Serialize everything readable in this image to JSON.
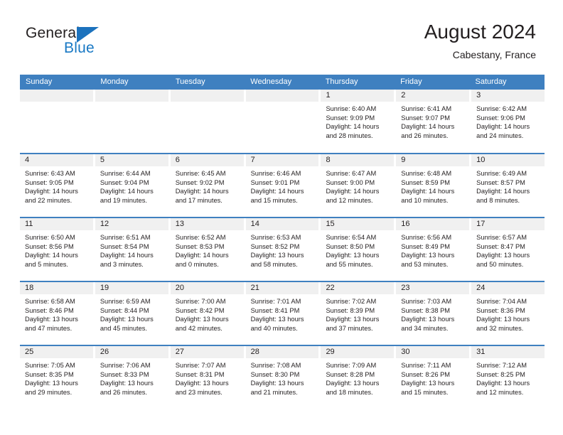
{
  "brand": {
    "name_top": "General",
    "name_bottom": "Blue",
    "triangle_color": "#1c72bd",
    "blue_text_color": "#1878c4"
  },
  "header": {
    "title": "August 2024",
    "subtitle": "Cabestany, France"
  },
  "theme": {
    "header_blue": "#3f80c0",
    "daynum_bg": "#f0f0f0",
    "text": "#231f20"
  },
  "weekdays": [
    "Sunday",
    "Monday",
    "Tuesday",
    "Wednesday",
    "Thursday",
    "Friday",
    "Saturday"
  ],
  "weeks": [
    [
      {
        "day": "",
        "sunrise": "",
        "sunset": "",
        "daylight": ""
      },
      {
        "day": "",
        "sunrise": "",
        "sunset": "",
        "daylight": ""
      },
      {
        "day": "",
        "sunrise": "",
        "sunset": "",
        "daylight": ""
      },
      {
        "day": "",
        "sunrise": "",
        "sunset": "",
        "daylight": ""
      },
      {
        "day": "1",
        "sunrise": "Sunrise: 6:40 AM",
        "sunset": "Sunset: 9:09 PM",
        "daylight": "Daylight: 14 hours and 28 minutes."
      },
      {
        "day": "2",
        "sunrise": "Sunrise: 6:41 AM",
        "sunset": "Sunset: 9:07 PM",
        "daylight": "Daylight: 14 hours and 26 minutes."
      },
      {
        "day": "3",
        "sunrise": "Sunrise: 6:42 AM",
        "sunset": "Sunset: 9:06 PM",
        "daylight": "Daylight: 14 hours and 24 minutes."
      }
    ],
    [
      {
        "day": "4",
        "sunrise": "Sunrise: 6:43 AM",
        "sunset": "Sunset: 9:05 PM",
        "daylight": "Daylight: 14 hours and 22 minutes."
      },
      {
        "day": "5",
        "sunrise": "Sunrise: 6:44 AM",
        "sunset": "Sunset: 9:04 PM",
        "daylight": "Daylight: 14 hours and 19 minutes."
      },
      {
        "day": "6",
        "sunrise": "Sunrise: 6:45 AM",
        "sunset": "Sunset: 9:02 PM",
        "daylight": "Daylight: 14 hours and 17 minutes."
      },
      {
        "day": "7",
        "sunrise": "Sunrise: 6:46 AM",
        "sunset": "Sunset: 9:01 PM",
        "daylight": "Daylight: 14 hours and 15 minutes."
      },
      {
        "day": "8",
        "sunrise": "Sunrise: 6:47 AM",
        "sunset": "Sunset: 9:00 PM",
        "daylight": "Daylight: 14 hours and 12 minutes."
      },
      {
        "day": "9",
        "sunrise": "Sunrise: 6:48 AM",
        "sunset": "Sunset: 8:59 PM",
        "daylight": "Daylight: 14 hours and 10 minutes."
      },
      {
        "day": "10",
        "sunrise": "Sunrise: 6:49 AM",
        "sunset": "Sunset: 8:57 PM",
        "daylight": "Daylight: 14 hours and 8 minutes."
      }
    ],
    [
      {
        "day": "11",
        "sunrise": "Sunrise: 6:50 AM",
        "sunset": "Sunset: 8:56 PM",
        "daylight": "Daylight: 14 hours and 5 minutes."
      },
      {
        "day": "12",
        "sunrise": "Sunrise: 6:51 AM",
        "sunset": "Sunset: 8:54 PM",
        "daylight": "Daylight: 14 hours and 3 minutes."
      },
      {
        "day": "13",
        "sunrise": "Sunrise: 6:52 AM",
        "sunset": "Sunset: 8:53 PM",
        "daylight": "Daylight: 14 hours and 0 minutes."
      },
      {
        "day": "14",
        "sunrise": "Sunrise: 6:53 AM",
        "sunset": "Sunset: 8:52 PM",
        "daylight": "Daylight: 13 hours and 58 minutes."
      },
      {
        "day": "15",
        "sunrise": "Sunrise: 6:54 AM",
        "sunset": "Sunset: 8:50 PM",
        "daylight": "Daylight: 13 hours and 55 minutes."
      },
      {
        "day": "16",
        "sunrise": "Sunrise: 6:56 AM",
        "sunset": "Sunset: 8:49 PM",
        "daylight": "Daylight: 13 hours and 53 minutes."
      },
      {
        "day": "17",
        "sunrise": "Sunrise: 6:57 AM",
        "sunset": "Sunset: 8:47 PM",
        "daylight": "Daylight: 13 hours and 50 minutes."
      }
    ],
    [
      {
        "day": "18",
        "sunrise": "Sunrise: 6:58 AM",
        "sunset": "Sunset: 8:46 PM",
        "daylight": "Daylight: 13 hours and 47 minutes."
      },
      {
        "day": "19",
        "sunrise": "Sunrise: 6:59 AM",
        "sunset": "Sunset: 8:44 PM",
        "daylight": "Daylight: 13 hours and 45 minutes."
      },
      {
        "day": "20",
        "sunrise": "Sunrise: 7:00 AM",
        "sunset": "Sunset: 8:42 PM",
        "daylight": "Daylight: 13 hours and 42 minutes."
      },
      {
        "day": "21",
        "sunrise": "Sunrise: 7:01 AM",
        "sunset": "Sunset: 8:41 PM",
        "daylight": "Daylight: 13 hours and 40 minutes."
      },
      {
        "day": "22",
        "sunrise": "Sunrise: 7:02 AM",
        "sunset": "Sunset: 8:39 PM",
        "daylight": "Daylight: 13 hours and 37 minutes."
      },
      {
        "day": "23",
        "sunrise": "Sunrise: 7:03 AM",
        "sunset": "Sunset: 8:38 PM",
        "daylight": "Daylight: 13 hours and 34 minutes."
      },
      {
        "day": "24",
        "sunrise": "Sunrise: 7:04 AM",
        "sunset": "Sunset: 8:36 PM",
        "daylight": "Daylight: 13 hours and 32 minutes."
      }
    ],
    [
      {
        "day": "25",
        "sunrise": "Sunrise: 7:05 AM",
        "sunset": "Sunset: 8:35 PM",
        "daylight": "Daylight: 13 hours and 29 minutes."
      },
      {
        "day": "26",
        "sunrise": "Sunrise: 7:06 AM",
        "sunset": "Sunset: 8:33 PM",
        "daylight": "Daylight: 13 hours and 26 minutes."
      },
      {
        "day": "27",
        "sunrise": "Sunrise: 7:07 AM",
        "sunset": "Sunset: 8:31 PM",
        "daylight": "Daylight: 13 hours and 23 minutes."
      },
      {
        "day": "28",
        "sunrise": "Sunrise: 7:08 AM",
        "sunset": "Sunset: 8:30 PM",
        "daylight": "Daylight: 13 hours and 21 minutes."
      },
      {
        "day": "29",
        "sunrise": "Sunrise: 7:09 AM",
        "sunset": "Sunset: 8:28 PM",
        "daylight": "Daylight: 13 hours and 18 minutes."
      },
      {
        "day": "30",
        "sunrise": "Sunrise: 7:11 AM",
        "sunset": "Sunset: 8:26 PM",
        "daylight": "Daylight: 13 hours and 15 minutes."
      },
      {
        "day": "31",
        "sunrise": "Sunrise: 7:12 AM",
        "sunset": "Sunset: 8:25 PM",
        "daylight": "Daylight: 13 hours and 12 minutes."
      }
    ]
  ]
}
